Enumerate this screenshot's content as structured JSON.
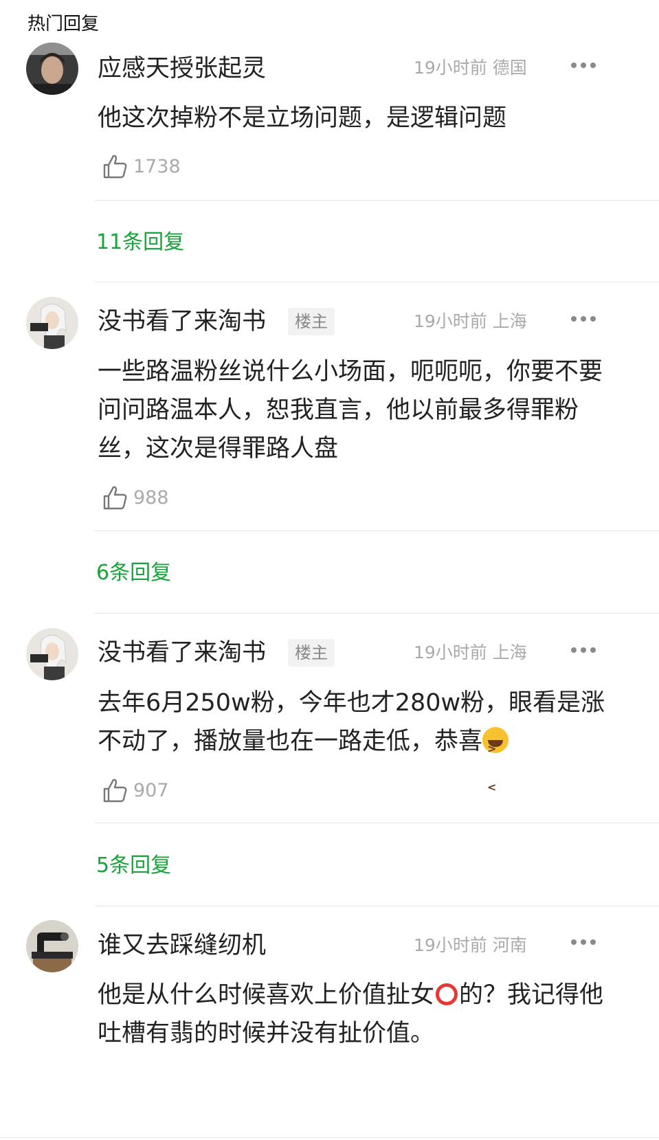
{
  "section_title": "热门回复",
  "comments": [
    {
      "username": "应感天授张起灵",
      "is_op": false,
      "time": "19小时前",
      "location": "德国",
      "content": "他这次掉粉不是立场问题，是逻辑问题",
      "likes": "1738",
      "replies": "11条回复"
    },
    {
      "username": "没书看了来淘书",
      "is_op": true,
      "op_tag": "楼主",
      "time": "19小时前",
      "location": "上海",
      "content": "一些路温粉丝说什么小场面，呃呃呃，你要不要问问路温本人，恕我直言，他以前最多得罪粉丝，这次是得罪路人盘",
      "likes": "988",
      "replies": "6条回复"
    },
    {
      "username": "没书看了来淘书",
      "is_op": true,
      "op_tag": "楼主",
      "time": "19小时前",
      "location": "上海",
      "content": "去年6月250w粉，今年也才280w粉，眼看是涨不动了，播放量也在一路走低，恭喜",
      "emoji": "laughing-emoji",
      "likes": "907",
      "replies": "5条回复"
    },
    {
      "username": "谁又去踩缝纫机",
      "is_op": false,
      "time": "19小时前",
      "location": "河南",
      "content_a": "他是从什么时候喜欢上价值扯女",
      "content_mark": "red-circle-emoji",
      "content_b": "的？我记得他吐槽有翡的时候并没有扯价值。"
    }
  ],
  "colors": {
    "reply_link": "#19a33b",
    "meta": "#aaaaaa",
    "divider": "#e6e6e6"
  }
}
